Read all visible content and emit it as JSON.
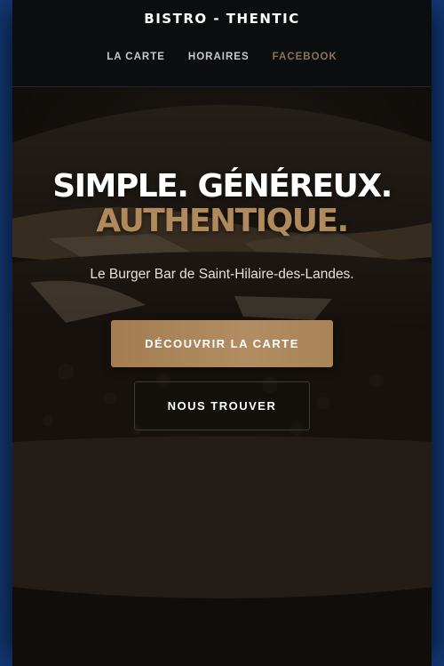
{
  "header": {
    "brand": "BISTRO - THENTIC",
    "nav": [
      {
        "label": "LA CARTE"
      },
      {
        "label": "HORAIRES"
      },
      {
        "label": "FACEBOOK"
      }
    ]
  },
  "hero": {
    "headline_line1": "SIMPLE. GÉNÉREUX.",
    "headline_line2": "AUTHENTIQUE.",
    "tagline": "Le Burger Bar de Saint-Hilaire-des-Landes.",
    "primary_button": "DÉCOUVRIR LA CARTE",
    "secondary_button": "NOUS TROUVER",
    "background_image": "burger-photo"
  },
  "colors": {
    "accent": "#b08a5c",
    "nav_accent": "#8a7356",
    "header_bg": "#0c0d0f",
    "text": "#ffffff"
  }
}
